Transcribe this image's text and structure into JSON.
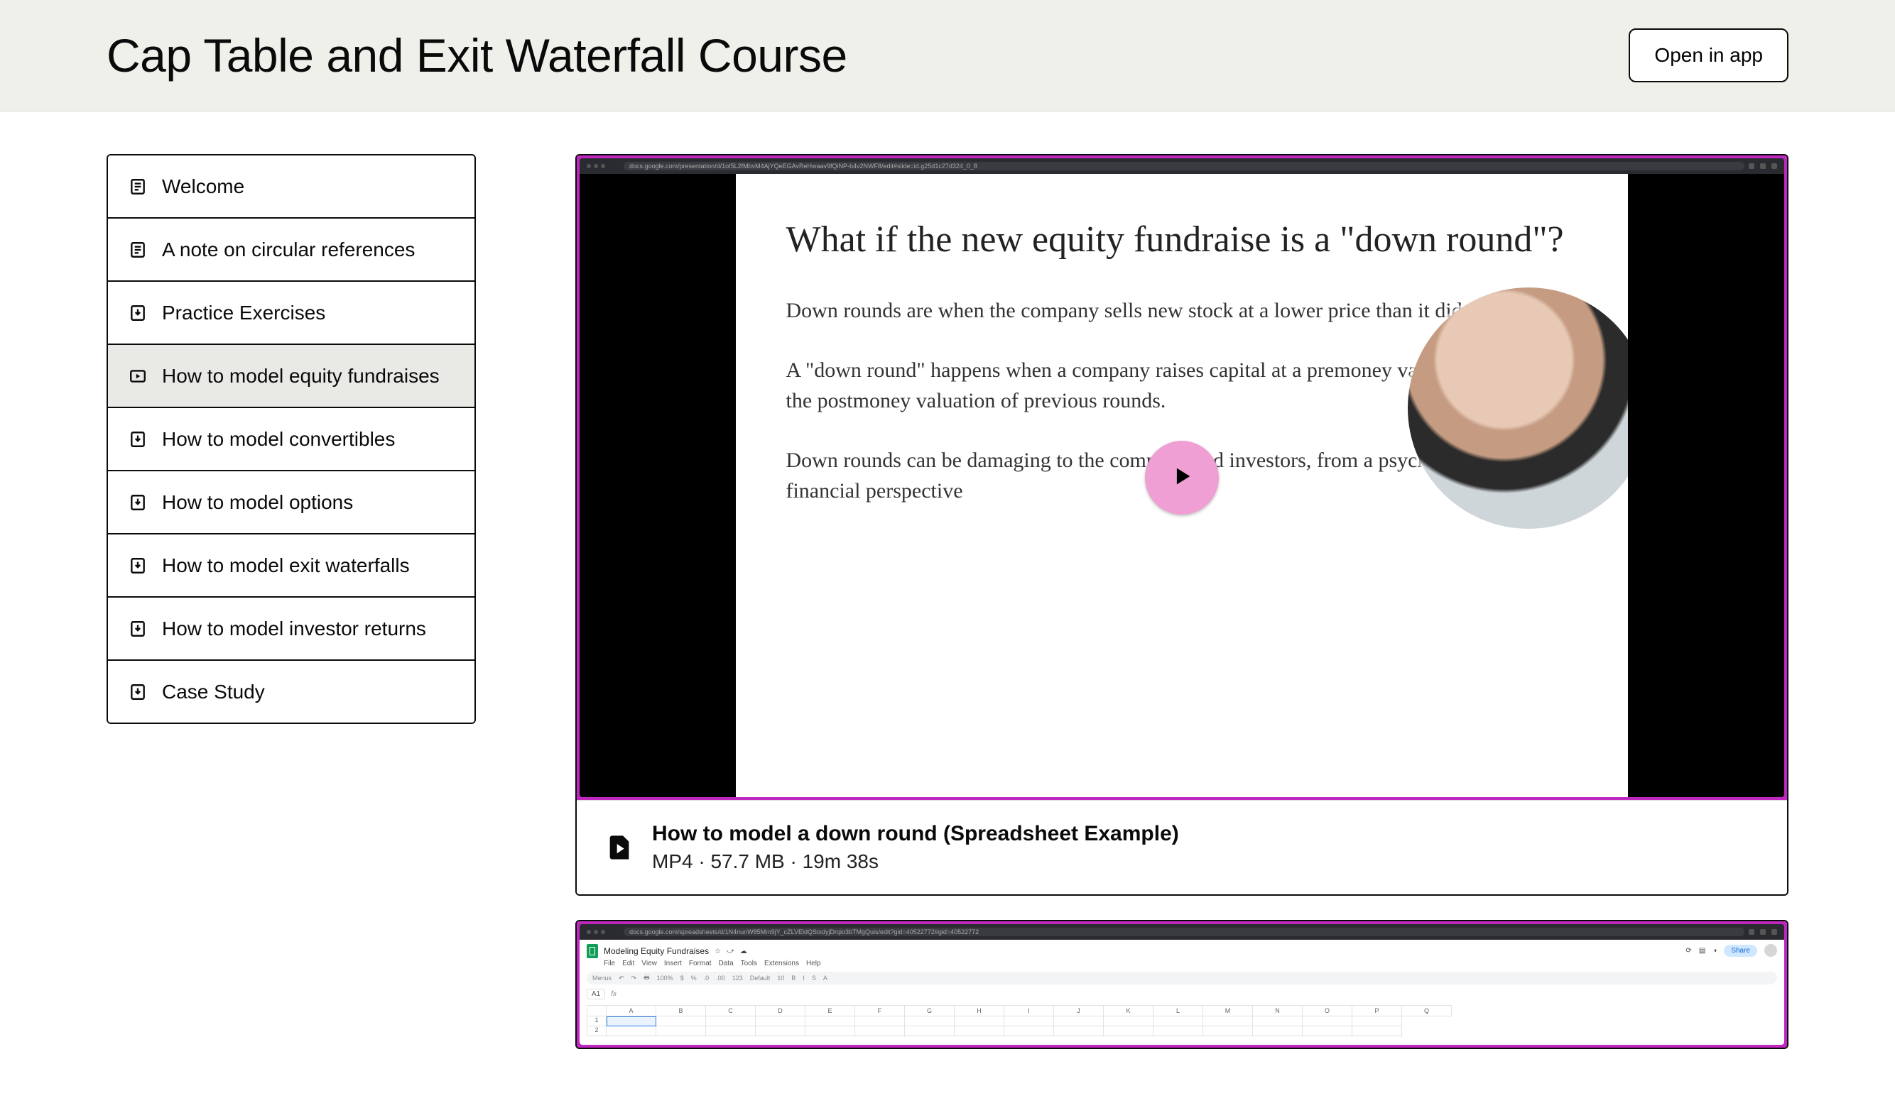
{
  "header": {
    "title": "Cap Table and Exit Waterfall Course",
    "open_in_app": "Open in app"
  },
  "sidebar": [
    {
      "kind": "doc",
      "label": "Welcome"
    },
    {
      "kind": "doc",
      "label": "A note on circular references"
    },
    {
      "kind": "download",
      "label": "Practice Exercises"
    },
    {
      "kind": "video",
      "label": "How to model equity fundraises",
      "active": true
    },
    {
      "kind": "download",
      "label": "How to model convertibles"
    },
    {
      "kind": "download",
      "label": "How to model options"
    },
    {
      "kind": "download",
      "label": "How to model exit waterfalls"
    },
    {
      "kind": "download",
      "label": "How to model investor returns"
    },
    {
      "kind": "download",
      "label": "Case Study"
    }
  ],
  "video1": {
    "browser_url": "docs.google.com/presentation/d/1oI5L2fMbvM4AjYQeEGAvReHwaav9fQiNP-b4v2NWF8/edit#slide=id.g25d1c27d324_0_8",
    "slide_title": "What if the new equity fundraise is a \"down round\"?",
    "slide_p1": "Down rounds are when the company sells new stock at a lower price than it did previously",
    "slide_p2": "A \"down round\" happens when a company raises capital at a premoney valuation less than the postmoney valuation of previous rounds.",
    "slide_p3": "Down rounds can be damaging to the company and investors, from a psyche, morale, and financial perspective",
    "file_title": "How to model a down round (Spreadsheet Example)",
    "file_meta": "MP4 · 57.7 MB · 19m 38s"
  },
  "video2": {
    "browser_url": "docs.google.com/spreadsheets/d/1N4nunW85Mm9jY_cZLVEldQStxdyjDrqio3bTMgQuis/edit?gid=40522772#gid=40522772",
    "doc_title": "Modeling Equity Fundraises",
    "menus": [
      "File",
      "Edit",
      "View",
      "Insert",
      "Format",
      "Data",
      "Tools",
      "Extensions",
      "Help"
    ],
    "toolbar_items": [
      "Menus",
      "↶",
      "↷",
      "🖶",
      "100%",
      "$",
      "%",
      ".0",
      ".00",
      "123",
      "Default",
      "10",
      "B",
      "I",
      "S",
      "A"
    ],
    "share_label": "Share",
    "cell_ref": "A1",
    "columns": [
      "A",
      "B",
      "C",
      "D",
      "E",
      "F",
      "G",
      "H",
      "I",
      "J",
      "K",
      "L",
      "M",
      "N",
      "O",
      "P",
      "Q"
    ]
  }
}
